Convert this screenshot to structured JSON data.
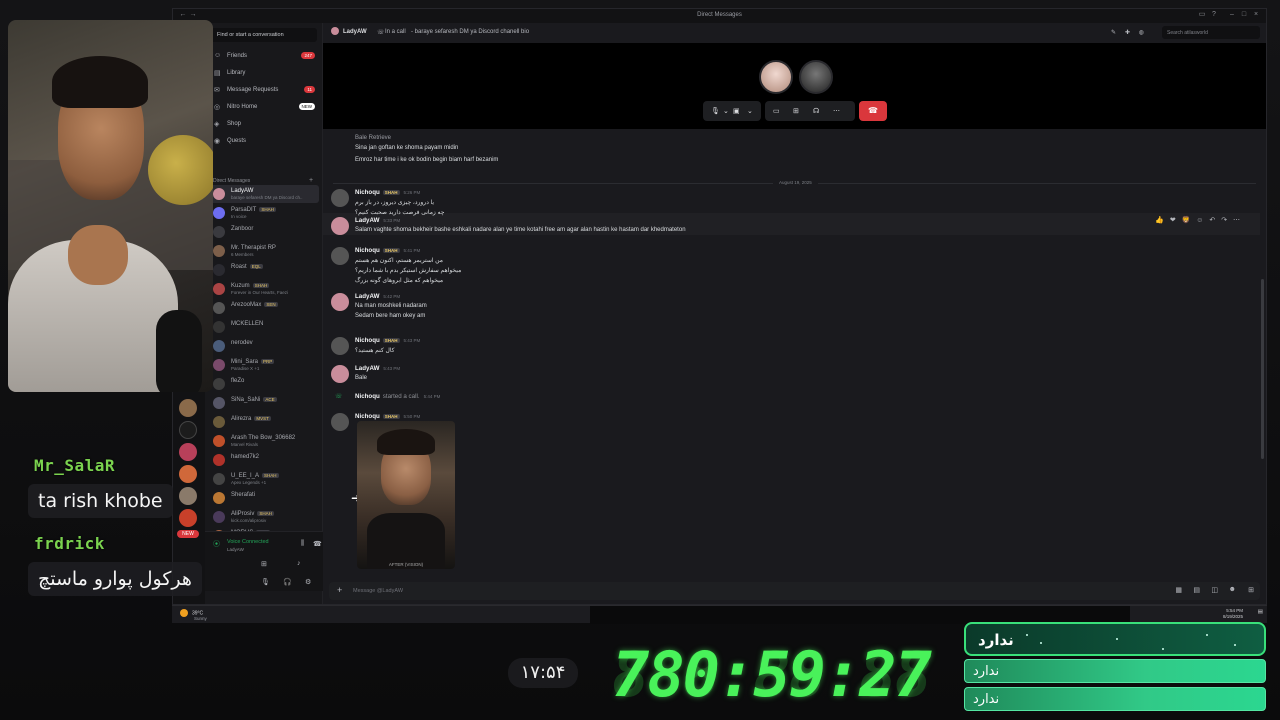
{
  "window": {
    "title": "Direct Messages"
  },
  "sidebar": {
    "search_placeholder": "Find or start a conversation",
    "nav": [
      {
        "label": "Friends",
        "badge": "247"
      },
      {
        "label": "Library"
      },
      {
        "label": "Message Requests",
        "badge": "11"
      },
      {
        "label": "Nitro Home",
        "badge": "NEW"
      },
      {
        "label": "Shop"
      },
      {
        "label": "Quests"
      }
    ],
    "dm_header": "Direct Messages",
    "dms": [
      {
        "name": "LadyAW",
        "sub": "baraye sefaresh DM ya Discord ch..",
        "color": "#c98d9b"
      },
      {
        "name": "ParsaDIT",
        "tag": "SHAH",
        "sub": "In voice",
        "color": "#6d6df0"
      },
      {
        "name": "Zanboor",
        "color": "#3a3a3f"
      },
      {
        "name": "Mr. Therapist RP",
        "sub": "6 Members",
        "color": "#7d5f4a"
      },
      {
        "name": "Roast",
        "tag": "EQL",
        "color": "#2a2a30"
      },
      {
        "name": "Kuzum",
        "tag": "SHAH",
        "sub": "Forever in Our Hearts, Faezi",
        "color": "#a44"
      },
      {
        "name": "ArezooMax",
        "tag": "SEN",
        "color": "#555"
      },
      {
        "name": "MCKELLEN",
        "color": "#333"
      },
      {
        "name": "nerodev",
        "color": "#4a5c7a"
      },
      {
        "name": "Mini_Sara",
        "tag": "PRP",
        "sub": "Paradise X +1",
        "color": "#7a4a6a"
      },
      {
        "name": "fleZo",
        "color": "#3d3d3d"
      },
      {
        "name": "SiNa_SaNi",
        "tag": "ACE",
        "color": "#556"
      },
      {
        "name": "Alirezra",
        "tag": "MVST",
        "color": "#6a5a3a"
      },
      {
        "name": "Arash The Bow_306682",
        "sub": "Marvel Rivals",
        "color": "#c0502a"
      },
      {
        "name": "hamed7k2",
        "color": "#b0322a"
      },
      {
        "name": "U_EE_I_A",
        "tag": "SHAH",
        "sub": "Apex Legends +1",
        "color": "#444"
      },
      {
        "name": "Sherafati",
        "color": "#bb7733"
      },
      {
        "name": "AliProsiv",
        "tag": "SHAH",
        "sub": "kick.com/aliprosiv",
        "color": "#4a3a5a"
      },
      {
        "name": "MORUS",
        "tag": "PRP",
        "sub": "Paradise X +1",
        "color": "#a64"
      }
    ],
    "voice": {
      "status": "Voice Connected",
      "channel": "LadyAW"
    }
  },
  "header": {
    "name": "LadyAW",
    "status": "In a call",
    "bio": "- baraye sefaresh DM ya Discord chanell bio",
    "search_placeholder": "Search atilasworld"
  },
  "messages": {
    "early": [
      "Sina jan goftan ke shoma payam midin",
      "Emroz har time i ke ok bodin begin biam harf bezanim"
    ],
    "date_divider": "August 19, 2025",
    "groups": [
      {
        "author": "Nichoqu",
        "tag": "SHAH",
        "time": "5:26 PM",
        "lines": [
          "یا درورد، چیزی دیروز، در باز برم",
          "چه زمانی فرصت دارید صحبت کنیم؟"
        ]
      },
      {
        "author": "LadyAW",
        "time": "5:33 PM",
        "lines": [
          "Salam vaghte shoma bekheir bashe eshkali nadare alan ye time kotahi free am agar alan hastin ke hastam dar khedmateton"
        ]
      },
      {
        "author": "Nichoqu",
        "tag": "SHAH",
        "time": "5:41 PM",
        "lines": [
          "من استریمر هستم، اکنون هم هستم",
          "میخواهم سفارش استیکر بدم با شما داریم؟",
          "میخواهم که مثل ابروهای گونه بزرگ"
        ]
      },
      {
        "author": "LadyAW",
        "time": "5:42 PM",
        "lines": [
          "Na man moshkeli nadaram",
          "Sedam bere ham okey am"
        ]
      },
      {
        "author": "Nichoqu",
        "tag": "SHAH",
        "time": "5:43 PM",
        "lines": [
          "کال کنم هستید؟"
        ]
      },
      {
        "author": "LadyAW",
        "time": "5:43 PM",
        "lines": [
          "Bale"
        ]
      },
      {
        "author": "Nichoqu",
        "system": "started a call.",
        "time": "5:44 PM"
      },
      {
        "author": "Nichoqu",
        "tag": "SHAH",
        "time": "5:50 PM",
        "attachment_caption": "AFTER (VISION)"
      }
    ],
    "reactions": "👍 ❤ 🦁 ☺ ↶ ↷ ⋯",
    "composer_placeholder": "Message @LadyAW"
  },
  "taskbar": {
    "temp": "39°C",
    "weather": "Sunny",
    "time": "5:54 PM",
    "date": "8/19/2025"
  },
  "overlay": {
    "chat": [
      {
        "user": "Mr_SalaR",
        "text": "ta rish khobe"
      },
      {
        "user": "frdrick",
        "text": "هرکول پوارو ماستچ"
      }
    ],
    "small_clock": "۱۷:۵۴",
    "big_timer": "780:59:27",
    "timer_ghost": "888:88:88",
    "panel_title": "ندارد",
    "pills": [
      "ندارد",
      "ندارد"
    ],
    "accent": "#49f25a"
  }
}
